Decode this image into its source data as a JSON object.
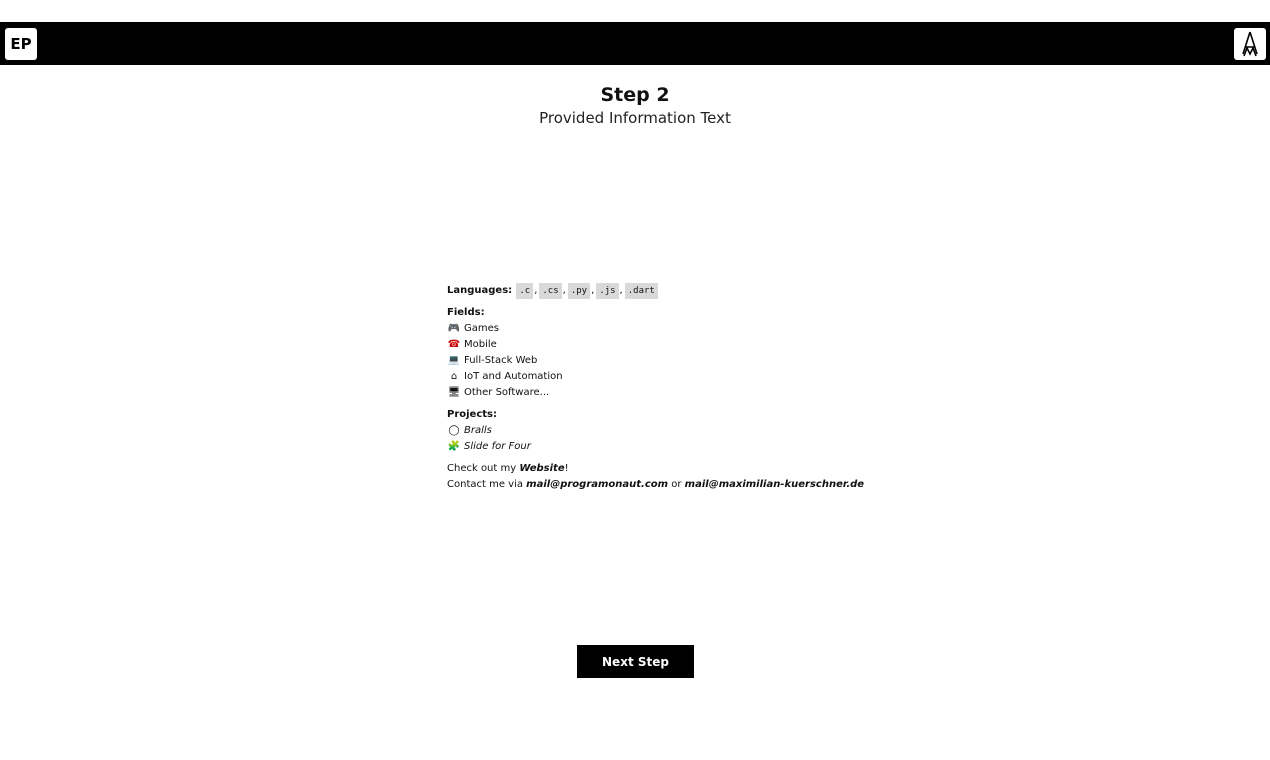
{
  "header": {
    "logo_left": "EP",
    "logo_right_icon": "am-monogram-icon"
  },
  "step": {
    "title": "Step 2",
    "subtitle": "Provided Information Text"
  },
  "info": {
    "languages_label": "Languages:",
    "languages": [
      ".c",
      ".cs",
      ".py",
      ".js",
      ".dart"
    ],
    "fields_label": "Fields:",
    "fields": [
      {
        "icon": "gamepad-icon",
        "glyph": "🎮",
        "label": "Games"
      },
      {
        "icon": "telephone-icon",
        "glyph": "☎",
        "label": "Mobile"
      },
      {
        "icon": "laptop-icon",
        "glyph": "💻",
        "label": "Full-Stack Web"
      },
      {
        "icon": "house-icon",
        "glyph": "⌂",
        "label": "IoT and Automation"
      },
      {
        "icon": "desktop-icon",
        "glyph": "🖥",
        "label": "Other Software..."
      }
    ],
    "projects_label": "Projects:",
    "projects": [
      {
        "icon": "ball-icon",
        "glyph": "◯",
        "label": "Bralls"
      },
      {
        "icon": "puzzle-icon",
        "glyph": "🧩",
        "label": "Slide for Four"
      }
    ],
    "website_prefix": "Check out my ",
    "website_link": "Website",
    "website_suffix": "!",
    "contact_prefix": "Contact me via ",
    "email_1": "mail@programonaut.com",
    "contact_or": " or ",
    "email_2": "mail@maximilian-kuerschner.de"
  },
  "actions": {
    "next_label": "Next Step"
  }
}
